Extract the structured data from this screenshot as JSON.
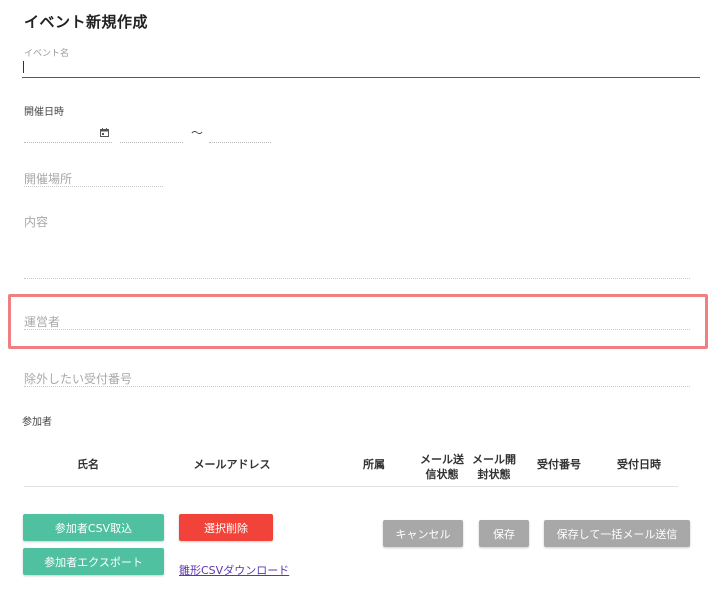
{
  "page": {
    "title": "イベント新規作成"
  },
  "form": {
    "event_name": {
      "label": "イベント名",
      "value": ""
    },
    "datetime": {
      "label": "開催日時",
      "separator": "〜"
    },
    "venue": {
      "placeholder": "開催場所"
    },
    "content": {
      "placeholder": "内容"
    },
    "operator": {
      "placeholder": "運営者"
    },
    "excluded_numbers": {
      "placeholder": "除外したい受付番号"
    }
  },
  "participants": {
    "label": "参加者",
    "columns": [
      {
        "line1": "氏名",
        "line2": ""
      },
      {
        "line1": "メールアドレス",
        "line2": ""
      },
      {
        "line1": "所属",
        "line2": ""
      },
      {
        "line1": "メール送",
        "line2": "信状態"
      },
      {
        "line1": "メール開",
        "line2": "封状態"
      },
      {
        "line1": "受付番号",
        "line2": ""
      },
      {
        "line1": "受付日時",
        "line2": ""
      }
    ]
  },
  "buttons": {
    "import_csv": "参加者CSV取込",
    "delete_selected": "選択削除",
    "export": "参加者エクスポート",
    "template_download": "雛形CSVダウンロード",
    "cancel": "キャンセル",
    "save": "保存",
    "save_and_send": "保存して一括メール送信"
  },
  "colors": {
    "accent_underline": "#3f51b5",
    "highlight": "#ef7f80",
    "green_button": "#4fc1a0",
    "red_button": "#f2433a",
    "gray_button": "#a8a8a8",
    "link": "#5e35b1"
  }
}
